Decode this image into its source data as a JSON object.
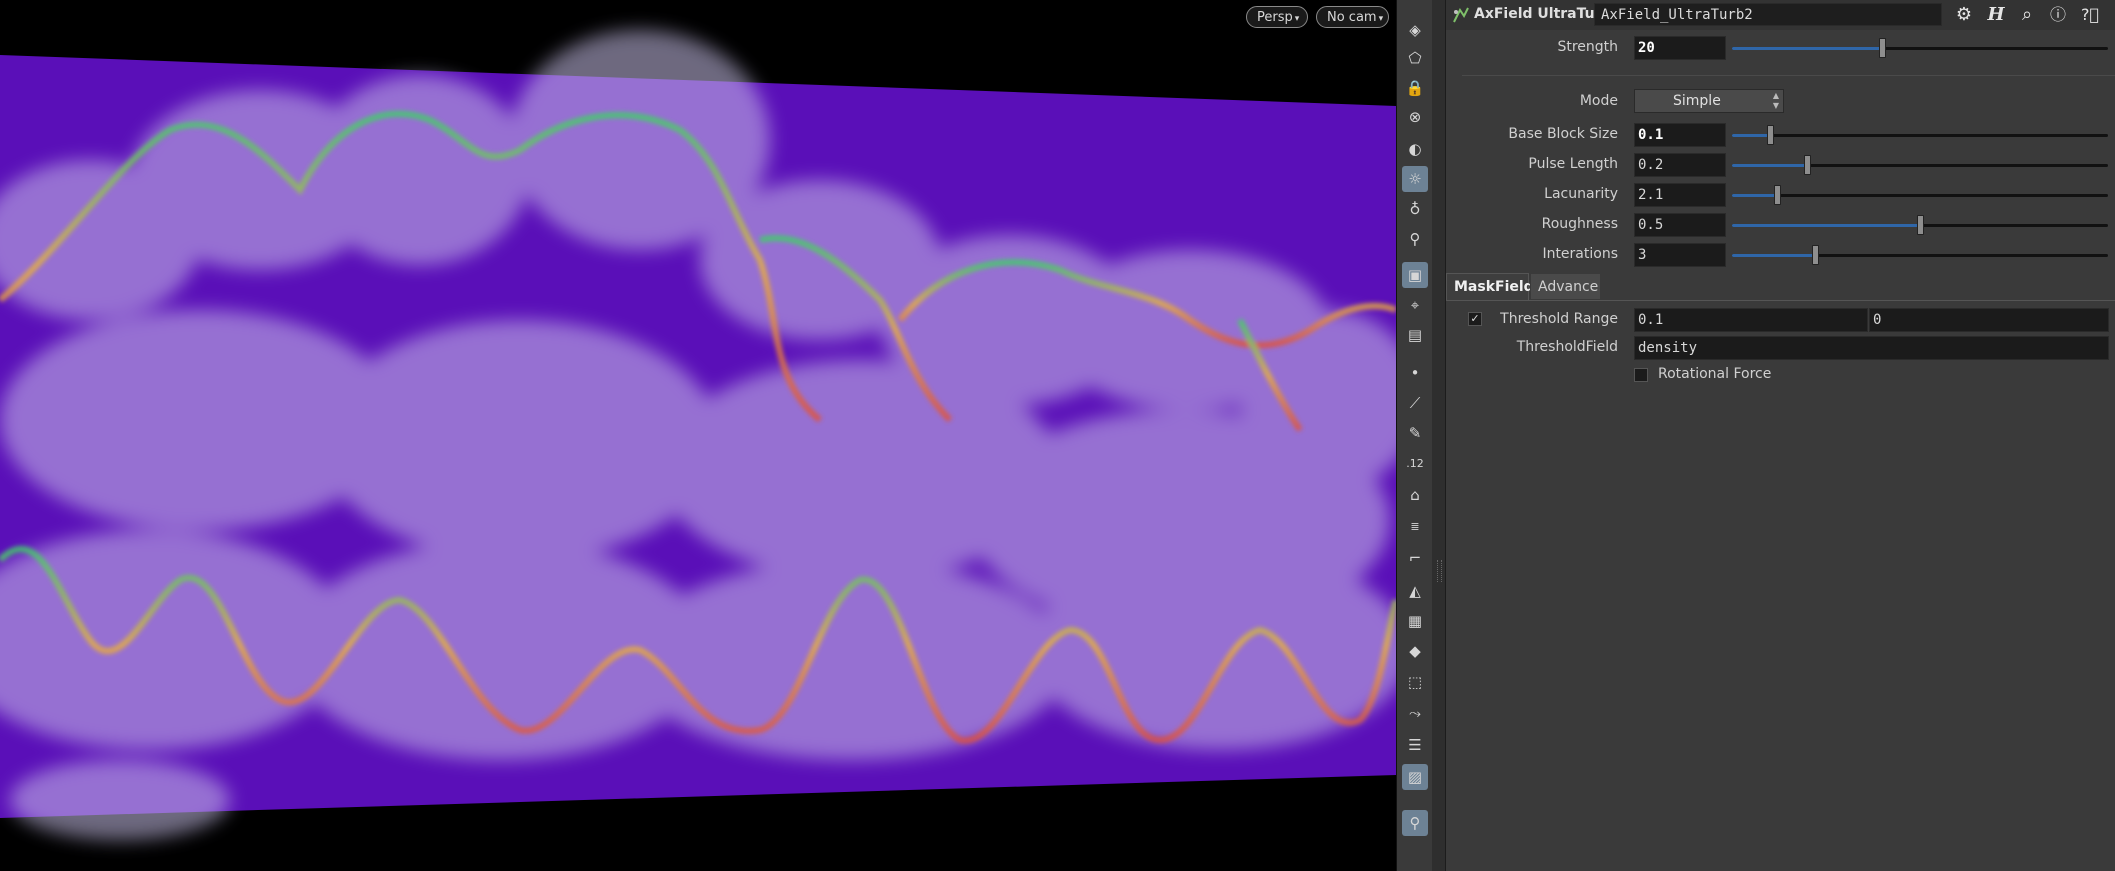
{
  "viewport": {
    "persp_label": "Persp",
    "cam_label": "No cam"
  },
  "toolbar": {
    "icons": [
      "view-icon",
      "select-icon",
      "lock-icon",
      "ghost-icon",
      "shading-icon",
      "light-icon",
      "bulb-icon",
      "headlight-icon",
      "camera-icon",
      "snap-icon",
      "display-icon",
      "point-icon",
      "brush-icon",
      "pen-icon",
      "number-icon",
      "paint-icon",
      "stack-icon",
      "curve-icon",
      "fan-icon",
      "texture-icon",
      "diamond-icon",
      "mesh-icon",
      "scatter-icon",
      "list-icon",
      "image-icon",
      "location-icon"
    ]
  },
  "header": {
    "node_type": "AxField UltraTurb",
    "node_name": "AxField_UltraTurb2"
  },
  "params": {
    "strength": {
      "label": "Strength",
      "value": "20",
      "slider": 0.4
    },
    "mode": {
      "label": "Mode",
      "value": "Simple"
    },
    "base_block_size": {
      "label": "Base Block Size",
      "value": "0.1",
      "slider": 0.1
    },
    "pulse_length": {
      "label": "Pulse Length",
      "value": "0.2",
      "slider": 0.2
    },
    "lacunarity": {
      "label": "Lacunarity",
      "value": "2.1",
      "slider": 0.12
    },
    "roughness": {
      "label": "Roughness",
      "value": "0.5",
      "slider": 0.5
    },
    "interations": {
      "label": "Interations",
      "value": "3",
      "slider": 0.22
    }
  },
  "tabs": [
    {
      "label": "MaskField"
    },
    {
      "label": "Advance"
    }
  ],
  "mask": {
    "threshold_range": {
      "label": "Threshold Range",
      "min": "0.1",
      "max": "0"
    },
    "threshold_field": {
      "label": "ThresholdField",
      "value": "density"
    },
    "rotational_force": {
      "label": "Rotational Force"
    }
  },
  "colors": {
    "background_plane": "#5a0fb8",
    "slider_fill": "#2f66a8",
    "panel_bg": "#3a3a3a"
  }
}
